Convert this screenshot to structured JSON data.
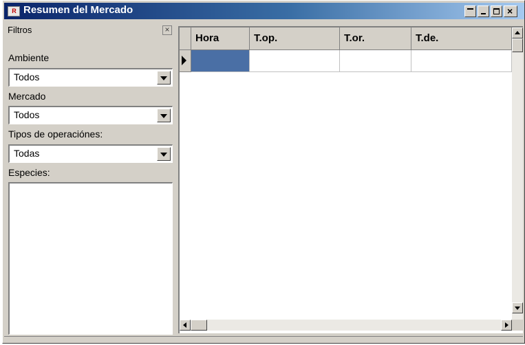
{
  "window": {
    "title": "Resumen del Mercado",
    "icon": "app-logo-icon",
    "icon_text": "R"
  },
  "filters": {
    "title": "Filtros",
    "close_glyph": "×",
    "ambiente": {
      "label": "Ambiente",
      "value": "Todos"
    },
    "mercado": {
      "label": "Mercado",
      "value": "Todos"
    },
    "tipos": {
      "label": "Tipos de operaciónes:",
      "value": "Todas"
    },
    "especies": {
      "label": "Especies:",
      "items": []
    }
  },
  "grid": {
    "columns": [
      "Hora",
      "T.op.",
      "T.or.",
      "T.de."
    ],
    "rows": [
      [
        "",
        "",
        "",
        ""
      ]
    ],
    "selected_color": "#4a6fa5"
  },
  "titlebar": {
    "close_glyph": "×"
  }
}
